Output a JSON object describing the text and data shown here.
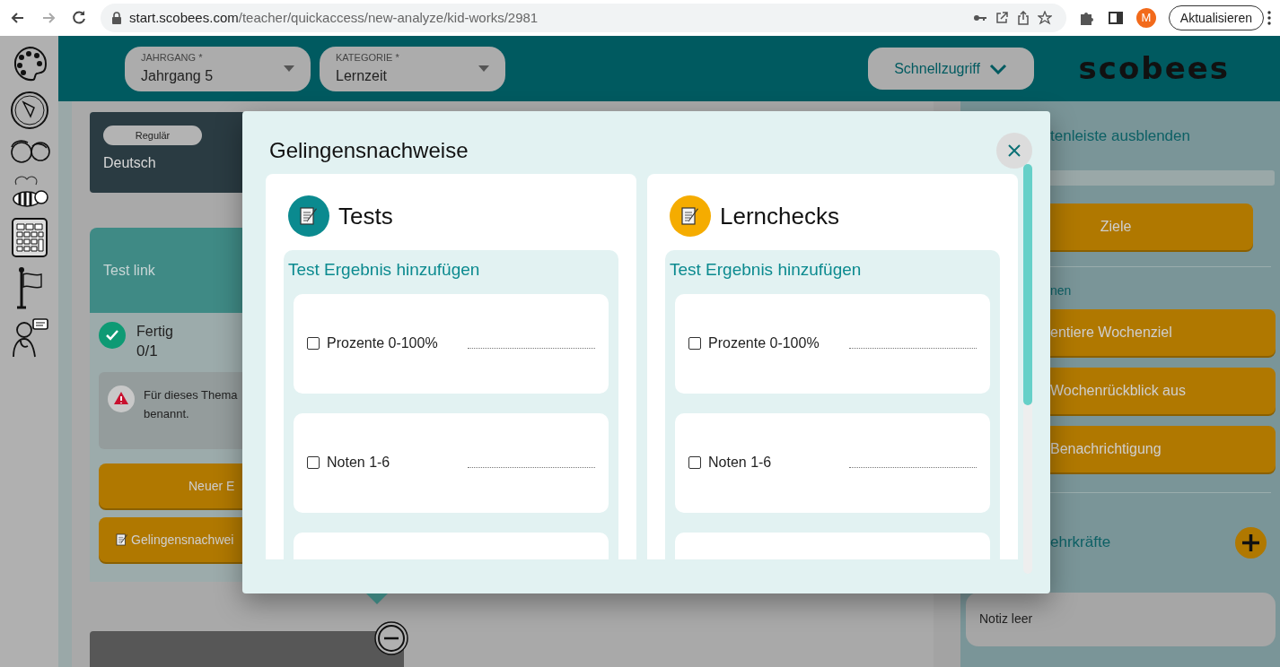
{
  "browser": {
    "url_host": "start.scobees.com",
    "url_path": "/teacher/quickaccess/new-analyze/kid-works/2981",
    "profile": "M",
    "update_button": "Aktualisieren"
  },
  "header": {
    "selects": [
      {
        "label": "JAHRGANG *",
        "value": "Jahrgang 5"
      },
      {
        "label": "KATEGORIE *",
        "value": "Lernzeit"
      }
    ],
    "quick_access": "Schnellzugriff",
    "logo": "scobees"
  },
  "subject_card": {
    "tag": "Regulär",
    "subject": "Deutsch"
  },
  "task_card": {
    "title": "Test link",
    "status": "Fertig",
    "count": "0/1",
    "done": true,
    "warning_lines": [
      "Für dieses Thema",
      "benannt."
    ],
    "buttons": [
      {
        "label": "Neuer E",
        "kind": "plain"
      },
      {
        "label": "Gelingensnachwei",
        "kind": "memo"
      }
    ]
  },
  "right_panel": {
    "toggle_link": "tenleiste ausblenden",
    "goals_button": "Ziele",
    "section_label": "nen",
    "actions": [
      "entiere Wochenziel",
      "Wochenrückblick aus",
      "Benachrichtigung"
    ],
    "teachers_label": "ehrkräfte",
    "note": "Notiz leer"
  },
  "modal": {
    "title": "Gelingensnachweise",
    "columns": [
      {
        "title": "Tests",
        "color": "#0b8a8f",
        "add_label": "Test Ergebnis hinzufügen",
        "options": [
          {
            "label": "Prozente 0-100%",
            "checked": false
          },
          {
            "label": "Noten 1-6",
            "checked": false
          }
        ]
      },
      {
        "title": "Lernchecks",
        "color": "#f5ac00",
        "add_label": "Test Ergebnis hinzufügen",
        "options": [
          {
            "label": "Prozente 0-100%",
            "checked": false
          },
          {
            "label": "Noten 1-6",
            "checked": false
          }
        ]
      }
    ]
  }
}
